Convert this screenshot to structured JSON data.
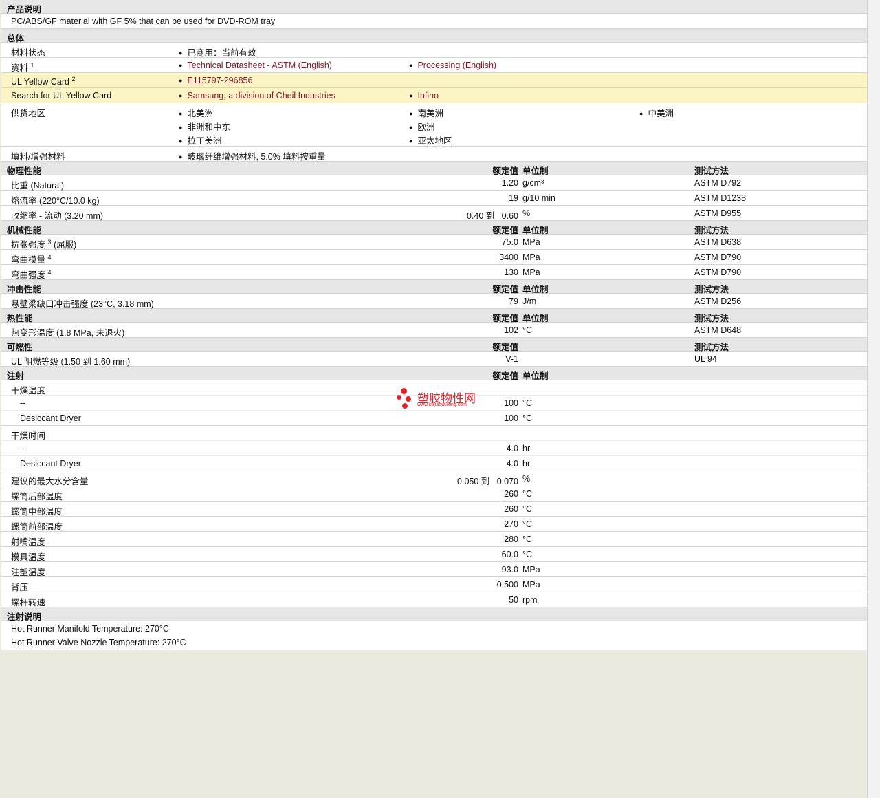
{
  "desc": {
    "header": "产品说明",
    "text": "PC/ABS/GF material with GF 5% that can be used for DVD-ROM tray"
  },
  "general": {
    "header": "总体",
    "status_label": "材料状态",
    "status_value": "已商用：当前有效",
    "docs_label": "资料",
    "docs_sup": "1",
    "doc1": "Technical Datasheet - ASTM (English)",
    "doc2": "Processing (English)",
    "ul_label": "UL Yellow Card",
    "ul_sup": "2",
    "ul_value": "E115797-296856",
    "search_label": "Search for UL Yellow Card",
    "search1": "Samsung, a division of Cheil Industries",
    "search2": "Infino",
    "regions_label": "供货地区",
    "regions": [
      "北美洲",
      "南美洲",
      "中美洲",
      "非洲和中东",
      "欧洲",
      "拉丁美洲",
      "亚太地区"
    ],
    "filler_label": "填料/增强材料",
    "filler_value": "玻璃纤维增强材料, 5.0% 填料按重量"
  },
  "cols": {
    "value": "额定值",
    "unit": "单位制",
    "method": "测试方法"
  },
  "physical": {
    "header": "物理性能",
    "rows": [
      {
        "label": "比重  (Natural)",
        "value": "1.20",
        "unit": "g/cm³",
        "method": "ASTM D792"
      },
      {
        "label": "熔流率  (220°C/10.0 kg)",
        "value": "19",
        "unit": "g/10 min",
        "method": "ASTM D1238"
      },
      {
        "label": "收缩率  - 流动  (3.20 mm)",
        "value": "0.40 到   0.60",
        "unit": "%",
        "method": "ASTM D955"
      }
    ]
  },
  "mechanical": {
    "header": "机械性能",
    "rows": [
      {
        "label": "抗张强度",
        "sup": "3",
        "suffix": " (屈服)",
        "value": "75.0",
        "unit": "MPa",
        "method": "ASTM D638"
      },
      {
        "label": "弯曲模量",
        "sup": "4",
        "suffix": "",
        "value": "3400",
        "unit": "MPa",
        "method": "ASTM D790"
      },
      {
        "label": "弯曲强度",
        "sup": "4",
        "suffix": "",
        "value": "130",
        "unit": "MPa",
        "method": "ASTM D790"
      }
    ]
  },
  "impact": {
    "header": "冲击性能",
    "rows": [
      {
        "label": "悬壁梁缺口冲击强度  (23°C, 3.18 mm)",
        "value": "79",
        "unit": "J/m",
        "method": "ASTM D256"
      }
    ]
  },
  "thermal": {
    "header": "热性能",
    "rows": [
      {
        "label": "热变形温度  (1.8 MPa, 未退火)",
        "value": "102",
        "unit": "°C",
        "method": "ASTM D648"
      }
    ]
  },
  "flammability": {
    "header": "可燃性",
    "rows": [
      {
        "label": "UL 阻燃等级  (1.50 到   1.60 mm)",
        "value": "V-1",
        "unit": "",
        "method": "UL 94"
      }
    ]
  },
  "injection": {
    "header": "注射",
    "dry_temp_label": "干燥温度",
    "dry_temp_rows": [
      {
        "label": "--",
        "value": "100",
        "unit": "°C"
      },
      {
        "label": "Desiccant Dryer",
        "value": "100",
        "unit": "°C"
      }
    ],
    "dry_time_label": "干燥时间",
    "dry_time_rows": [
      {
        "label": "--",
        "value": "4.0",
        "unit": "hr"
      },
      {
        "label": "Desiccant Dryer",
        "value": "4.0",
        "unit": "hr"
      }
    ],
    "rows": [
      {
        "label": "建议的最大水分含量",
        "value": "0.050 到   0.070",
        "unit": "%"
      },
      {
        "label": "螺筒后部温度",
        "value": "260",
        "unit": "°C"
      },
      {
        "label": "螺筒中部温度",
        "value": "260",
        "unit": "°C"
      },
      {
        "label": "螺筒前部温度",
        "value": "270",
        "unit": "°C"
      },
      {
        "label": "射嘴温度",
        "value": "280",
        "unit": "°C"
      },
      {
        "label": "模具温度",
        "value": "60.0",
        "unit": "°C"
      },
      {
        "label": "注塑温度",
        "value": "93.0",
        "unit": "MPa"
      },
      {
        "label": "背压",
        "value": "0.500",
        "unit": "MPa"
      },
      {
        "label": "螺杆转速",
        "value": "50",
        "unit": "rpm"
      }
    ]
  },
  "notes": {
    "header": "注射说明",
    "lines": [
      "Hot Runner Manifold Temperature: 270°C",
      "Hot Runner Valve Nozzle Temperature: 270°C"
    ]
  },
  "watermark": {
    "text": "塑胶物性网",
    "url": "www.sujiaowuxing.com",
    "color": "#e8222b"
  }
}
